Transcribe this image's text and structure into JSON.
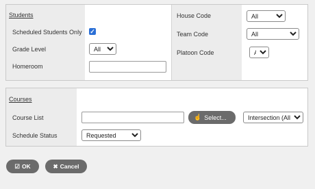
{
  "students": {
    "section_title": "Students",
    "scheduled_only_label": "Scheduled Students Only",
    "scheduled_only_checked": true,
    "grade_level_label": "Grade Level",
    "grade_level_value": "All",
    "homeroom_label": "Homeroom",
    "homeroom_value": "",
    "house_code_label": "House Code",
    "house_code_value": "All",
    "team_code_label": "Team Code",
    "team_code_value": "All",
    "platoon_code_label": "Platoon Code",
    "platoon_code_value": "All"
  },
  "courses": {
    "section_title": "Courses",
    "course_list_label": "Course List",
    "course_list_value": "",
    "select_button_label": "Select...",
    "intersection_value": "Intersection (All)",
    "schedule_status_label": "Schedule Status",
    "schedule_status_value": "Requested"
  },
  "footer": {
    "ok_label": "OK",
    "cancel_label": "Cancel"
  }
}
